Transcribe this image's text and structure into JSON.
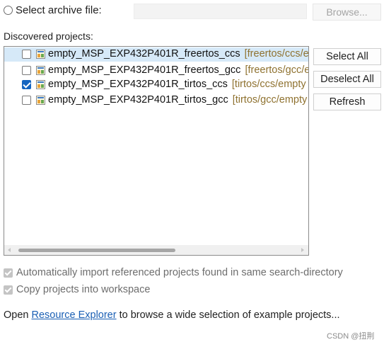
{
  "archive": {
    "label": "Select archive file:",
    "value": "",
    "browse_label": "Browse..."
  },
  "projects": {
    "label": "Discovered projects:",
    "items": [
      {
        "name": "empty_MSP_EXP432P401R_freertos_ccs",
        "path": "[freertos/ccs/e",
        "checked": false,
        "selected": true
      },
      {
        "name": "empty_MSP_EXP432P401R_freertos_gcc",
        "path": "[freertos/gcc/e",
        "checked": false,
        "selected": false
      },
      {
        "name": "empty_MSP_EXP432P401R_tirtos_ccs",
        "path": "[tirtos/ccs/empty",
        "checked": true,
        "selected": false
      },
      {
        "name": "empty_MSP_EXP432P401R_tirtos_gcc",
        "path": "[tirtos/gcc/empty",
        "checked": false,
        "selected": false
      }
    ]
  },
  "buttons": {
    "select_all": "Select All",
    "deselect_all": "Deselect All",
    "refresh": "Refresh"
  },
  "options": {
    "auto_import": "Automatically import referenced projects found in same search-directory",
    "copy_projects": "Copy projects into workspace"
  },
  "footer": {
    "prefix": "Open ",
    "link": "Resource Explorer",
    "suffix": " to browse a wide selection of example projects..."
  },
  "watermark": "CSDN @扭荆",
  "colors": {
    "selection": "#d6e9f8",
    "path_text": "#8f7230",
    "link": "#1a5fb4",
    "checked": "#1565c0"
  }
}
